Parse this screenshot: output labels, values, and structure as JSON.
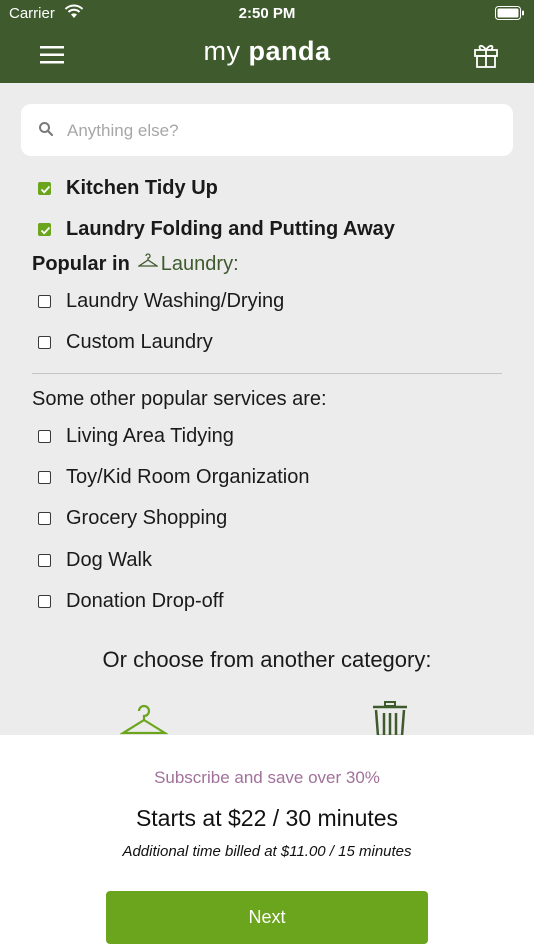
{
  "status_bar": {
    "carrier": "Carrier",
    "time": "2:50 PM"
  },
  "header": {
    "brand_part1": "my",
    "brand_part2": "panda"
  },
  "search": {
    "placeholder": "Anything else?"
  },
  "selected_services": [
    {
      "label": "Kitchen Tidy Up",
      "checked": true
    },
    {
      "label": "Laundry Folding and Putting Away",
      "checked": true
    }
  ],
  "popular": {
    "prefix": "Popular in",
    "category": "Laundry:",
    "items": [
      {
        "label": "Laundry Washing/Drying",
        "checked": false
      },
      {
        "label": "Custom Laundry",
        "checked": false
      }
    ]
  },
  "other": {
    "title": "Some other popular services are:",
    "items": [
      {
        "label": "Living Area Tidying",
        "checked": false
      },
      {
        "label": "Toy/Kid Room Organization",
        "checked": false
      },
      {
        "label": "Grocery Shopping",
        "checked": false
      },
      {
        "label": "Dog Walk",
        "checked": false
      },
      {
        "label": "Donation Drop-off",
        "checked": false
      }
    ]
  },
  "categories": {
    "title": "Or choose from another category:",
    "icons": [
      "hanger-icon",
      "trash-icon"
    ]
  },
  "footer": {
    "promo": "Subscribe and save over 30%",
    "price": "Starts at $22 / 30 minutes",
    "additional": "Additional time billed at $11.00 / 15 minutes",
    "next_label": "Next"
  },
  "colors": {
    "header_green": "#3f5a2d",
    "accent_green": "#6ba51d",
    "promo_mauve": "#a0719a",
    "background": "#ececec"
  }
}
